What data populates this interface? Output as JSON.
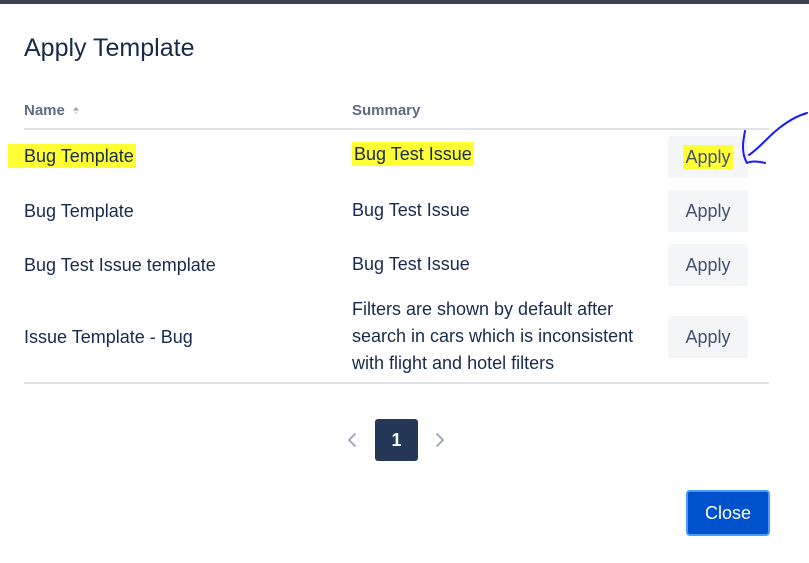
{
  "dialog": {
    "title": "Apply Template"
  },
  "table": {
    "columns": {
      "name": "Name",
      "summary": "Summary"
    },
    "rows": [
      {
        "name": "Bug Template",
        "summary": "Bug Test Issue",
        "action": "Apply",
        "highlighted": true
      },
      {
        "name": "Bug Template",
        "summary": "Bug Test Issue",
        "action": "Apply",
        "highlighted": false
      },
      {
        "name": "Bug Test Issue template",
        "summary": "Bug Test Issue",
        "action": "Apply",
        "highlighted": false
      },
      {
        "name": "Issue Template - Bug",
        "summary": "Filters are shown by default after search in cars which is inconsistent with flight and hotel filters",
        "action": "Apply",
        "highlighted": false
      }
    ]
  },
  "pagination": {
    "current_page": "1",
    "prev_icon": "chevron-left-icon",
    "next_icon": "chevron-right-icon"
  },
  "footer": {
    "close_label": "Close"
  },
  "colors": {
    "highlight": "#ffff33",
    "primary": "#0052cc",
    "page_active": "#253858",
    "annotation_ink": "#1a1aff"
  }
}
